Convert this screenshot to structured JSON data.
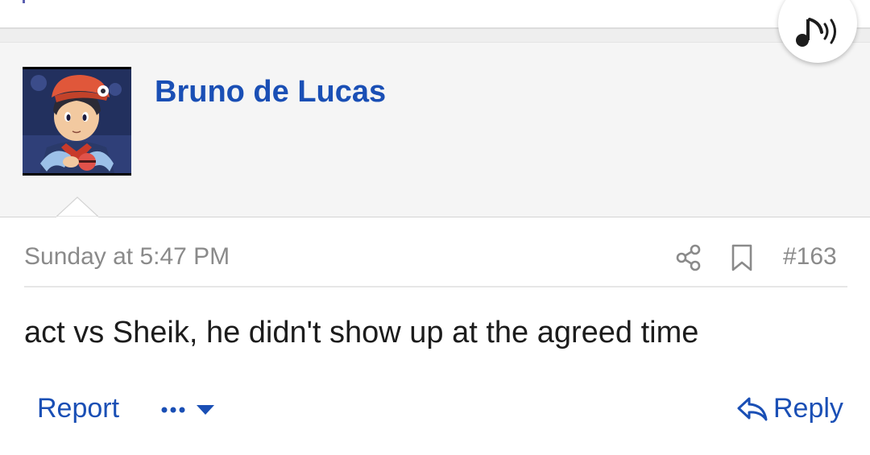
{
  "post": {
    "username": "Bruno de Lucas",
    "timestamp": "Sunday at 5:47 PM",
    "post_number": "#163",
    "message": "act vs Sheik, he didn't show up at the agreed time"
  },
  "actions": {
    "report_label": "Report",
    "reply_label": "Reply"
  },
  "icons": {
    "music": "music-note-sound-icon",
    "share": "share-icon",
    "bookmark": "bookmark-icon",
    "more": "more-dots-icon",
    "reply": "reply-arrow-icon"
  },
  "colors": {
    "link": "#1a4fb5",
    "meta": "#8a8a8a",
    "panel": "#f5f5f5"
  }
}
